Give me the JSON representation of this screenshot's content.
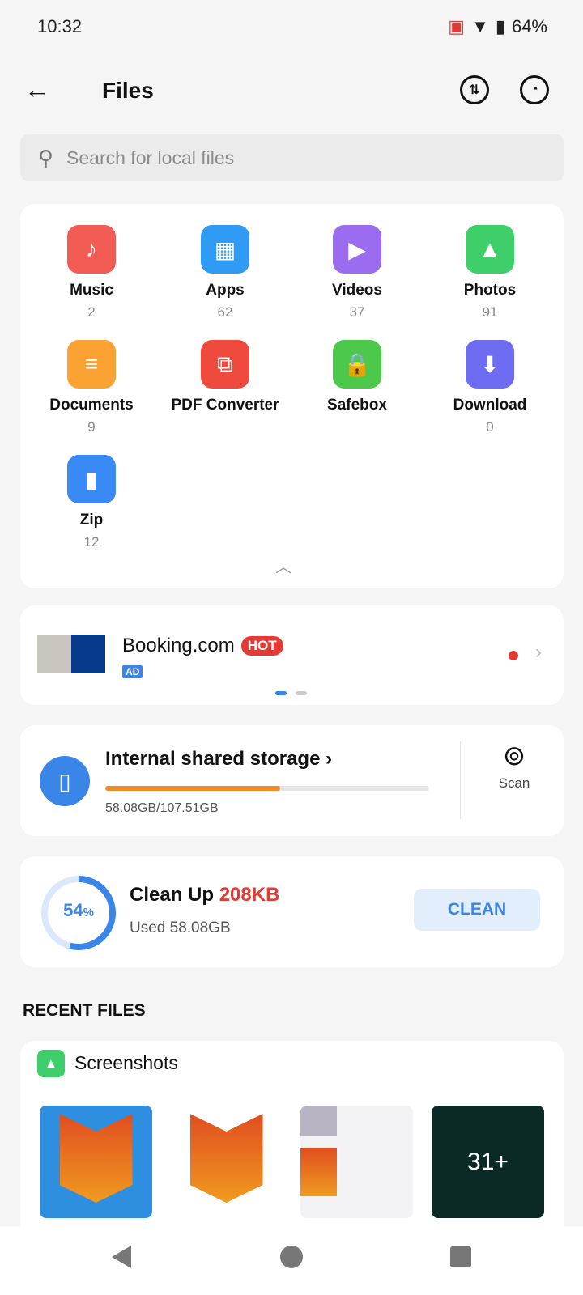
{
  "status": {
    "time": "10:32",
    "battery": "64%"
  },
  "header": {
    "title": "Files"
  },
  "search": {
    "placeholder": "Search for local files"
  },
  "categories": [
    {
      "label": "Music",
      "count": "2",
      "color": "#f25c54"
    },
    {
      "label": "Apps",
      "count": "62",
      "color": "#2f9bf5"
    },
    {
      "label": "Videos",
      "count": "37",
      "color": "#9b6cf0"
    },
    {
      "label": "Photos",
      "count": "91",
      "color": "#3ecf6a"
    },
    {
      "label": "Documents",
      "count": "9",
      "color": "#fba232"
    },
    {
      "label": "PDF Converter",
      "count": "",
      "color": "#f04a3e"
    },
    {
      "label": "Safebox",
      "count": "",
      "color": "#4cc94a"
    },
    {
      "label": "Download",
      "count": "0",
      "color": "#6e6cf2"
    },
    {
      "label": "Zip",
      "count": "12",
      "color": "#3a8af5"
    }
  ],
  "ad": {
    "title": "Booking.com",
    "hot": "HOT",
    "ad_label": "AD"
  },
  "storage": {
    "title": "Internal shared storage",
    "usage": "58.08GB/107.51GB",
    "used_fraction": 0.54,
    "scan": "Scan"
  },
  "clean": {
    "percent": "54",
    "percent_sign": "%",
    "title": "Clean Up",
    "size": "208KB",
    "used": "Used 58.08GB",
    "button": "CLEAN"
  },
  "recent": {
    "heading": "RECENT FILES",
    "folder": "Screenshots",
    "more": "31+"
  },
  "colors": {
    "accent": "#3a86e8",
    "orange": "#f28c28",
    "red": "#e53935"
  }
}
